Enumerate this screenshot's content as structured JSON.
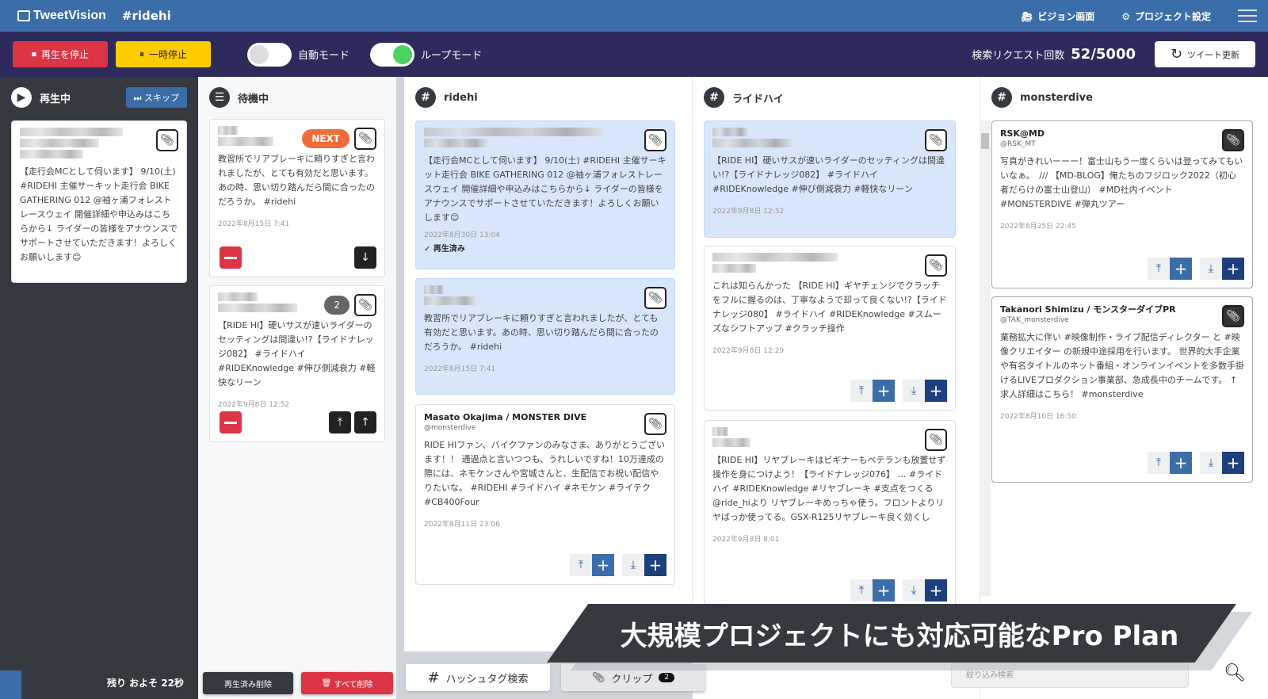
{
  "header": {
    "logo": "TweetVision",
    "project": "#ridehi",
    "vision_screen": "ビジョン画面",
    "project_settings": "プロジェクト設定"
  },
  "toolbar": {
    "stop": "再生を停止",
    "pause": "一時停止",
    "auto_mode": "自動モード",
    "auto_mode_on": false,
    "loop_mode": "ループモード",
    "loop_mode_on": true,
    "request_label": "検索リクエスト回数",
    "request_count": "52/5000",
    "refresh": "ツイート更新"
  },
  "colors": {
    "header": "#3b6ea8",
    "toolbar": "#2d2b5b",
    "stop": "#dc3545",
    "pause": "#ffcc00",
    "next": "#f26b3a"
  },
  "playing": {
    "title": "再生中",
    "skip": "スキップ",
    "card": {
      "text": "【走行会MCとして伺います】 9/10(土) #RIDEHI 主催サーキット走行会 BIKE GATHERING 012 @袖ヶ浦フォレストレースウェイ 開催詳細や申込みはこちらから↓ ライダーの皆様をアナウンスでサポートさせていただきます！よろしくお願いします😊"
    },
    "remaining": "残り およそ 22秒"
  },
  "waiting": {
    "title": "待機中",
    "cards": [
      {
        "badge": "NEXT",
        "text": "教習所でリアブレーキに頼りすぎと言われましたが、とても有効だと思います。あの時、思い切り踏んだら間に合ったのだろうか。 #ridehi",
        "date": "2022年8月15日 7:41"
      },
      {
        "badge": "2",
        "text": "【RIDE HI】硬いサスが速いライダーのセッティングは間違い!?【ライドナレッジ082】 #ライドハイ #RIDEKnowledge #伸び側減衰力 #軽快なリーン",
        "date": "2022年9月8日 12:52"
      }
    ],
    "delete_played": "再生済み削除",
    "delete_all": "すべて削除"
  },
  "columns": [
    {
      "title": "ridehi",
      "cards": [
        {
          "text": "【走行会MCとして伺います】 9/10(土) #RIDEHI 主催サーキット走行会 BIKE GATHERING 012 @袖ヶ浦フォレストレースウェイ 開催詳細や申込みはこちらから↓ ライダーの皆様をアナウンスでサポートさせていただきます！よろしくお願いします😊",
          "date": "2022年8月30日 13:04",
          "status": "再生済み"
        },
        {
          "text": "教習所でリアブレーキに頼りすぎと言われましたが、とても有効だと思います。あの時、思い切り踏んだら間に合ったのだろうか。 #ridehi",
          "date": "2022年8月15日 7:41"
        },
        {
          "name": "Masato Okajima / MONSTER DIVE",
          "handle": "@monsterdive",
          "text": "RIDE HIファン、バイクファンのみなさま、ありがとうございます！！ 通過点と言いつつも、うれしいですね！10万達成の際には、ネモケンさんや宮城さんと、生配信でお祝い配信やりたいな。 #RIDEHI #ライドハイ #ネモケン #ライテク #CB400Four",
          "date": "2022年8月11日 23:06"
        }
      ]
    },
    {
      "title": "ライドハイ",
      "cards": [
        {
          "text": "【RIDE HI】硬いサスが速いライダーのセッティングは間違い!?【ライドナレッジ082】 #ライドハイ #RIDEKnowledge #伸び側減衰力 #軽快なリーン",
          "date": "2022年9月8日 12:52"
        },
        {
          "text": "これは知らんかった 【RIDE HI】ギヤチェンジでクラッチをフルに握るのは、丁寧なようで却って良くない!?【ライドナレッジ080】 #ライドハイ #RIDEKnowledge #スムーズなシフトアップ #クラッチ操作",
          "date": "2022年9月8日 12:29"
        },
        {
          "text": "【RIDE HI】リヤブレーキはビギナーもベテランも放置せず操作を身につけよう！【ライドナレッジ076】 … #ライドハイ #RIDEKnowledge #リヤブレーキ #支点をつくる @ride_hiより リヤブレーキめっちゃ使う。フロントよりリヤばっか使ってる。GSX-R125リヤブレーキ良く効くし",
          "date": "2022年9月8日 8:01"
        }
      ]
    },
    {
      "title": "monsterdive",
      "cards": [
        {
          "name": "RSK@MD",
          "handle": "@RSK_MT",
          "text": "写真がきれいーーー！富士山もう一度くらいは登ってみてもいいなぁ。　/// 【MD-BLOG】俺たちのフジロック2022（初心者だらけの富士山登山） #MD社内イベント #MONSTERDIVE #弾丸ツアー",
          "date": "2022年8月25日 22:45"
        },
        {
          "name": "Takanori Shimizu / モンスターダイブPR",
          "handle": "@TAK_monsterdive",
          "text": "業務拡大に伴い #映像制作・ライブ配信ディレクター と #映像クリエイター の新規中途採用を行います。 世界的大手企業や有名タイトルのネット番組・オンラインイベントを多数手掛けるLIVEプロダクション事業部、急成長中のチームです。 ↑求人詳細はこちら！ #monsterdive",
          "date": "2022年8月10日 16:50"
        }
      ]
    }
  ],
  "bottom": {
    "tab_hashtag": "ハッシュタグ検索",
    "tab_clip": "クリップ",
    "clip_count": "2",
    "filter_placeholder": "絞り込み検索"
  },
  "banner": "大規模プロジェクトにも対応可能なPro Plan"
}
